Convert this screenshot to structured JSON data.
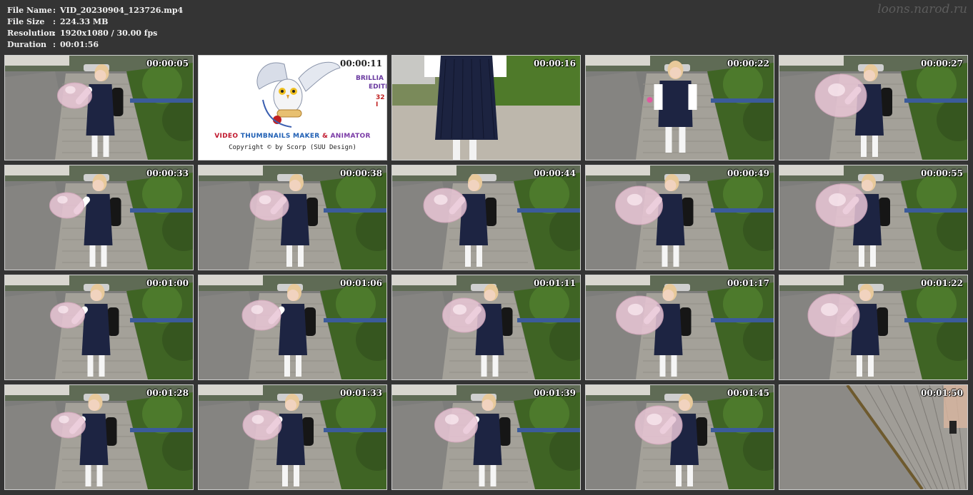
{
  "info": {
    "rows": [
      {
        "key": "File Name",
        "value": "VID_20230904_123726.mp4"
      },
      {
        "key": "File Size",
        "value": "224.33 MB"
      },
      {
        "key": "Resolution",
        "value": "1920x1080 / 30.00 fps"
      },
      {
        "key": "Duration",
        "value": "00:01:56"
      }
    ],
    "separator": ":"
  },
  "watermark": "loons.narod.ru",
  "logo_frame": {
    "brand_parts": [
      "VIDEO ",
      "THUMBNAILS MAKER",
      " & ",
      "ANIMATOR"
    ],
    "copyright": "Copyright © by Scorp (SUU Design)",
    "side_lines": [
      "BRILLIA",
      "EDITI",
      "32 I"
    ]
  },
  "colors": {
    "background": "#343434",
    "brand_red": "#c0162c",
    "brand_blue": "#1f5fb4",
    "brand_purple": "#7a3aa6"
  },
  "thumbnails": [
    {
      "time": "00:00:05",
      "kind": "girl-balloon"
    },
    {
      "time": "00:00:11",
      "kind": "logo"
    },
    {
      "time": "00:00:16",
      "kind": "skirt-closeup"
    },
    {
      "time": "00:00:22",
      "kind": "girl-standing"
    },
    {
      "time": "00:00:27",
      "kind": "girl-balloon"
    },
    {
      "time": "00:00:33",
      "kind": "girl-balloon"
    },
    {
      "time": "00:00:38",
      "kind": "girl-balloon"
    },
    {
      "time": "00:00:44",
      "kind": "girl-balloon"
    },
    {
      "time": "00:00:49",
      "kind": "girl-balloon"
    },
    {
      "time": "00:00:55",
      "kind": "girl-balloon"
    },
    {
      "time": "00:01:00",
      "kind": "girl-balloon"
    },
    {
      "time": "00:01:06",
      "kind": "girl-balloon"
    },
    {
      "time": "00:01:11",
      "kind": "girl-balloon"
    },
    {
      "time": "00:01:17",
      "kind": "girl-balloon"
    },
    {
      "time": "00:01:22",
      "kind": "girl-balloon"
    },
    {
      "time": "00:01:28",
      "kind": "girl-balloon"
    },
    {
      "time": "00:01:33",
      "kind": "girl-balloon"
    },
    {
      "time": "00:01:39",
      "kind": "girl-balloon"
    },
    {
      "time": "00:01:45",
      "kind": "girl-balloon"
    },
    {
      "time": "00:01:50",
      "kind": "pavement"
    }
  ]
}
